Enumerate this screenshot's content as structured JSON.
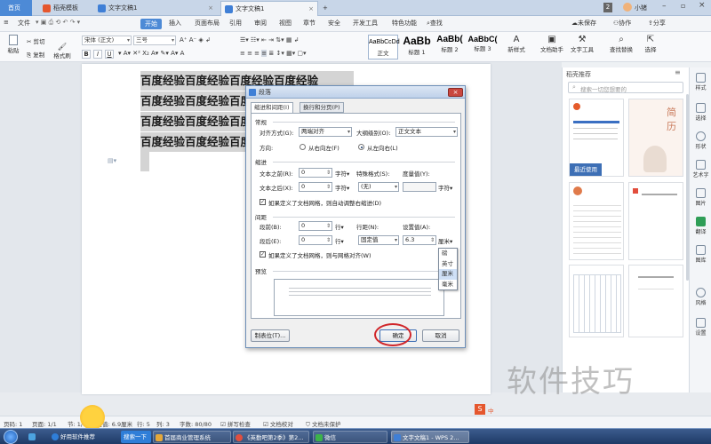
{
  "tabs": {
    "home": "首页",
    "template": "稻壳模板",
    "doc1": "文字文稿1",
    "doc1_active": "文字文稿1",
    "badge": "2",
    "user": "小猪"
  },
  "menu": {
    "file": "文件",
    "start": "开始",
    "insert": "插入",
    "layout": "页面布局",
    "reference": "引用",
    "review": "审阅",
    "view": "视图",
    "chapter": "章节",
    "security": "安全",
    "dev": "开发工具",
    "special": "特色功能",
    "search": "查找",
    "unsynced": "未保存",
    "coop": "协作",
    "share": "分享"
  },
  "ribbon": {
    "paste": "粘贴",
    "cut": "剪切",
    "copy": "复制",
    "format_painter": "格式刷",
    "font": "宋体 (正文)",
    "size": "三号",
    "styles": [
      {
        "big": "AaBbCcDd",
        "lbl": "正文"
      },
      {
        "big": "AaBb",
        "lbl": "标题 1"
      },
      {
        "big": "AaBb(",
        "lbl": "标题 2"
      },
      {
        "big": "AaBbC(",
        "lbl": "标题 3"
      }
    ],
    "new_style": "新样式",
    "doc_helper": "文档助手",
    "text_tool": "文字工具",
    "find_replace": "查找替换",
    "select": "选择"
  },
  "doc": {
    "line": "百度经验百度经验百度经验百度经验"
  },
  "rpanel": {
    "title": "稻壳推荐",
    "search_placeholder": "搜索一切您想要的",
    "recent": "最近使用",
    "resume_char": "简",
    "resume_char2": "历"
  },
  "rside": [
    "样式",
    "选择",
    "形状",
    "艺术字",
    "图片",
    "翻译",
    "图库",
    "风格",
    "设置"
  ],
  "dialog": {
    "title": "段落",
    "tab1": "缩进和间距(I)",
    "tab2": "换行和分页(P)",
    "general": "常规",
    "align_label": "对齐方式(G):",
    "align_value": "两端对齐",
    "outline_label": "大纲级别(O):",
    "outline_value": "正文文本",
    "direction_label": "方向:",
    "rtl": "从右向左(F)",
    "ltr": "从左向右(L)",
    "indent": "缩进",
    "before_text_label": "文本之前(R):",
    "before_text_value": "0",
    "unit_char": "字符",
    "special_label": "特殊格式(S):",
    "special_value": "(无)",
    "measure_label": "度量值(Y):",
    "after_text_label": "文本之后(X):",
    "after_text_value": "0",
    "grid_indent": "如果定义了文档网格，则自动调整右缩进(D)",
    "spacing": "间距",
    "before_label": "段前(B):",
    "before_value": "0",
    "unit_line": "行",
    "linespacing_label": "行距(N):",
    "linespacing_value": "固定值",
    "setvalue_label": "设置值(A):",
    "setvalue_value": "6.3",
    "unit_mm": "厘米",
    "after_label": "段后(E):",
    "after_value": "0",
    "grid_align": "如果定义了文档网格，则与网格对齐(W)",
    "preview": "预览",
    "tabs_btn": "制表位(T)...",
    "ok": "确定",
    "cancel": "取消"
  },
  "unit_options": [
    "磅",
    "英寸",
    "厘米",
    "毫米"
  ],
  "status": {
    "page": "页码: 1",
    "pages": "页面: 1/1",
    "section": "节: 1/1",
    "setvalue": "设置值: 6.9厘米",
    "row": "行: 5",
    "col": "列: 3",
    "words": "字数: 80/80",
    "spell": "拼写检查",
    "proofread": "文档校对",
    "protect": "文档未保护",
    "ime": "中"
  },
  "taskbar": {
    "tip": "好用软件推荐",
    "search": "搜索一下",
    "app1": "首届商业管理系统",
    "app2": "《英勤吧第2季》第2...",
    "app3": "微信",
    "app4": "文字文稿1 - WPS 2..."
  },
  "watermark": "软件技巧"
}
